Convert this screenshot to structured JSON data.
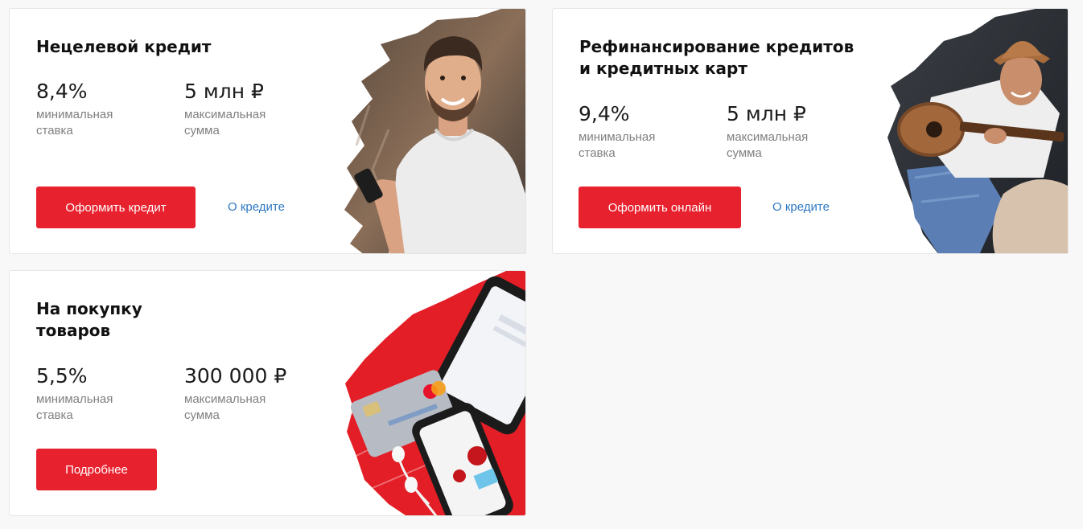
{
  "colors": {
    "accent": "#e8212e",
    "link": "#2d77c2",
    "caption": "#808080"
  },
  "cards": [
    {
      "title": "Нецелевой кредит",
      "rate_value": "8,4%",
      "rate_caption": "минимальная\nставка",
      "amount_value": "5 млн ₽",
      "amount_caption": "максимальная\nсумма",
      "button_label": "Оформить кредит",
      "link_label": "О кредите",
      "image": "smiling-man-with-phone-photo"
    },
    {
      "title": "Рефинансирование кредитов\nи кредитных карт",
      "rate_value": "9,4%",
      "rate_caption": "минимальная\nставка",
      "amount_value": "5 млн ₽",
      "amount_caption": "максимальная\nсумма",
      "button_label": "Оформить онлайн",
      "link_label": "О кредите",
      "image": "man-with-guitar-photo"
    },
    {
      "title": "На покупку\nтоваров",
      "rate_value": "5,5%",
      "rate_caption": "минимальная\nставка",
      "amount_value": "300 000 ₽",
      "amount_caption": "максимальная\nсумма",
      "button_label": "Подробнее",
      "image": "devices-and-cards-illustration"
    }
  ]
}
